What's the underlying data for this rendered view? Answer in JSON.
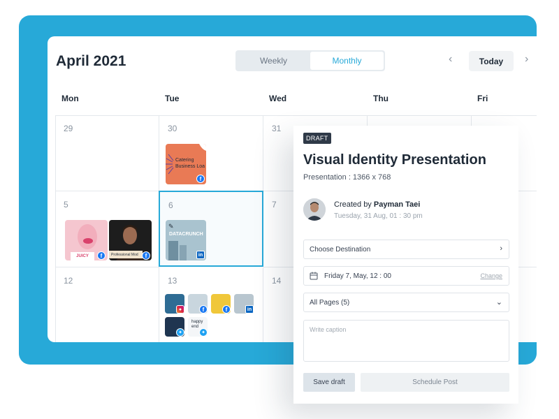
{
  "calendar": {
    "month_title": "April 2021",
    "view_toggle": {
      "weekly": "Weekly",
      "monthly": "Monthly",
      "active": "Monthly"
    },
    "nav": {
      "prev_icon": "chevron-left-icon",
      "today_label": "Today",
      "next_icon": "chevron-right-icon"
    },
    "day_headers": [
      "Mon",
      "Tue",
      "Wed",
      "Thu",
      "Fri"
    ],
    "day_numbers": {
      "r0c0": "29",
      "r0c1": "30",
      "r0c2": "31",
      "r1c0": "5",
      "r1c1": "6",
      "r1c2": "7",
      "r2c0": "12",
      "r2c1": "13",
      "r2c2": "14"
    },
    "posts": {
      "catering_text": "Catering Business Loa",
      "juicy_text": "JUICY",
      "model_text": "Professional Mod",
      "datacrunch_text": "DATACRUNCH",
      "happy_text": "happy end"
    }
  },
  "panel": {
    "status_tag": "DRAFT",
    "title": "Visual Identity Presentation",
    "subtitle": "Presentation : 1366 x 768",
    "created_by_prefix": "Created by",
    "author": "Payman Taei",
    "created_time": "Tuesday, 31 Aug, 01 : 30 pm",
    "destination": "Choose Destination",
    "date_value": "Friday 7, May, 12 : 00",
    "change_link": "Change",
    "pages_select": "All Pages (5)",
    "caption_placeholder": "Write caption",
    "save_draft": "Save draft",
    "schedule_post": "Schedule Post"
  },
  "colors": {
    "accent": "#27a9d8",
    "facebook": "#1877f2",
    "linkedin": "#0a66c2",
    "twitter": "#1da1f2",
    "panel_dark": "#2f3a48"
  }
}
